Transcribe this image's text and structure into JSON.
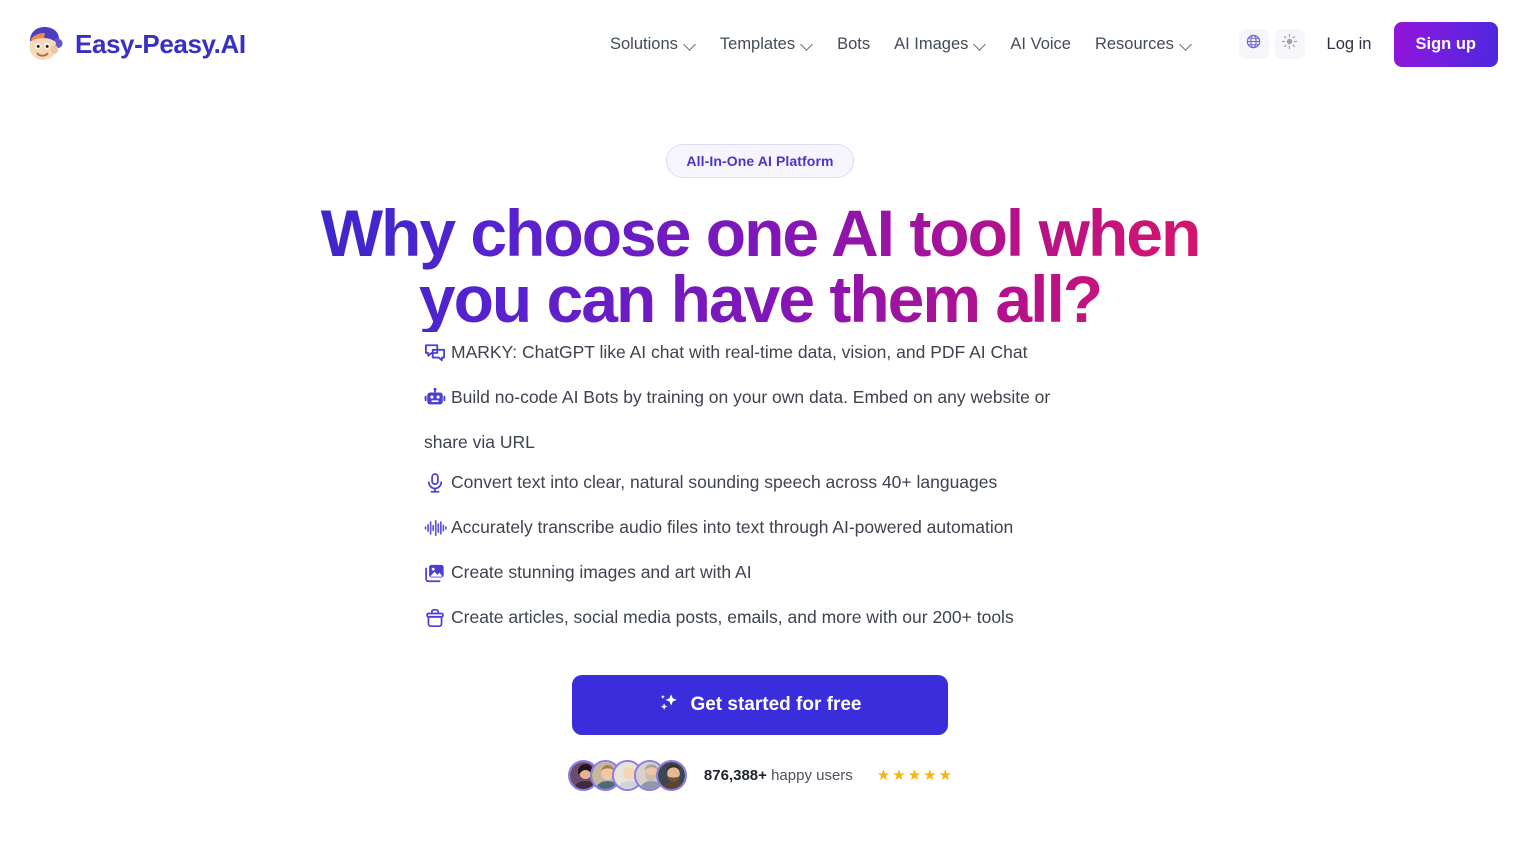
{
  "brand": {
    "name": "Easy-Peasy.AI",
    "logo_icon": "mascot-face-cap-icon"
  },
  "nav": {
    "items": [
      {
        "label": "Solutions",
        "has_dropdown": true
      },
      {
        "label": "Templates",
        "has_dropdown": true
      },
      {
        "label": "Bots",
        "has_dropdown": false
      },
      {
        "label": "AI Images",
        "has_dropdown": true
      },
      {
        "label": "AI Voice",
        "has_dropdown": false
      },
      {
        "label": "Resources",
        "has_dropdown": true
      }
    ]
  },
  "header_actions": {
    "language_icon": "globe-icon",
    "theme_icon": "sun-icon",
    "login_label": "Log in",
    "signup_label": "Sign up"
  },
  "hero": {
    "badge": "All-In-One AI Platform",
    "headline_line1": "Why choose one AI tool when",
    "headline_line2": "you can have them all?",
    "headline_gradient_from": "#3b28cc",
    "headline_gradient_to": "#d6156b"
  },
  "features": [
    {
      "icon": "chat-bubbles-icon",
      "text": "MARKY: ChatGPT like AI chat with real-time data, vision, and PDF AI Chat"
    },
    {
      "icon": "robot-icon",
      "text": "Build no-code AI Bots by training on your own data. Embed on any website or share via URL"
    },
    {
      "icon": "microphone-icon",
      "text": "Convert text into clear, natural sounding speech across 40+ languages"
    },
    {
      "icon": "audio-waveform-icon",
      "text": "Accurately transcribe audio files into text through AI-powered automation"
    },
    {
      "icon": "image-icon",
      "text": "Create stunning images and art with AI"
    },
    {
      "icon": "toolbox-icon",
      "text": "Create articles, social media posts, emails, and more with our 200+ tools"
    }
  ],
  "cta": {
    "icon": "sparkle-icon",
    "label": "Get started for free",
    "color": "#3a2ddb"
  },
  "social_proof": {
    "count": "876,388+",
    "suffix": "happy users",
    "avatar_count": 5,
    "stars": 5,
    "star_color": "#f5b50a"
  }
}
